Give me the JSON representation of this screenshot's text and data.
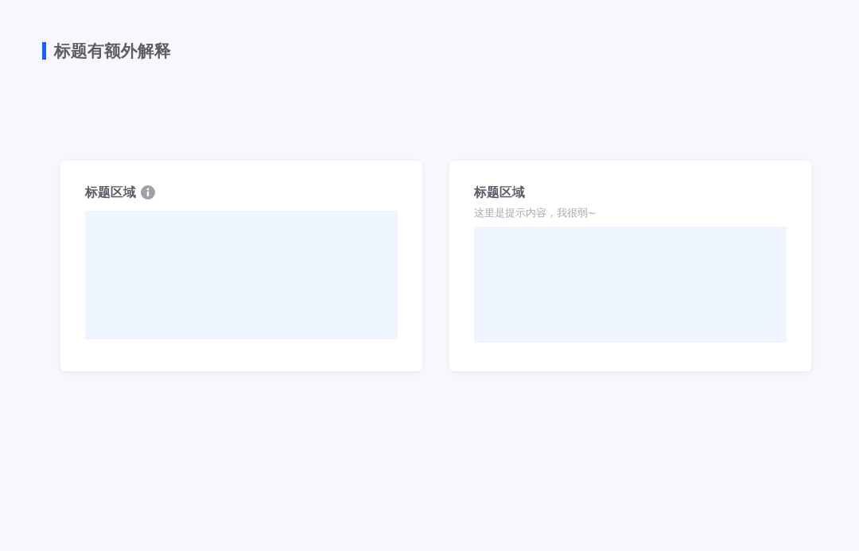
{
  "heading": {
    "title": "标题有额外解释"
  },
  "cards": [
    {
      "kind": "info_icon",
      "title": "标题区域"
    },
    {
      "kind": "hint",
      "title": "标题区域",
      "hint": "这里是提示内容，我很弱~"
    }
  ]
}
